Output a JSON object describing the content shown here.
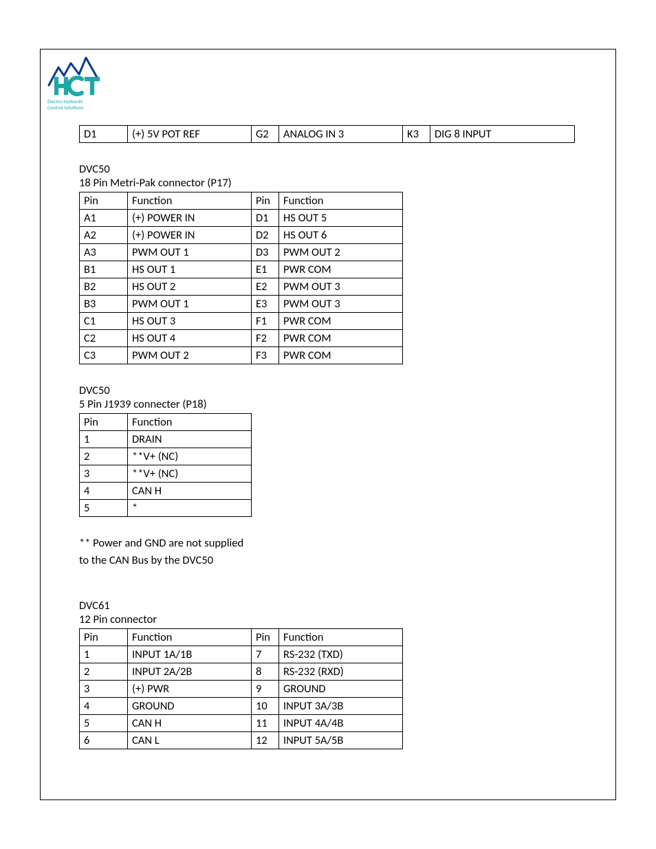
{
  "logo": {
    "line1": "Electro-Hydraulic",
    "line2": "Control Solutions"
  },
  "top_row": {
    "cells": [
      "D1",
      "(+) 5V POT REF",
      "G2",
      "ANALOG IN 3",
      "K3",
      "DIG 8 INPUT"
    ]
  },
  "table1": {
    "title": "DVC50",
    "subtitle": "18 Pin Metri-Pak connector (P17)",
    "headers": [
      "Pin",
      "Function",
      "Pin",
      "Function"
    ],
    "rows": [
      [
        "A1",
        "(+) POWER IN",
        "D1",
        "HS OUT 5"
      ],
      [
        "A2",
        "(+) POWER IN",
        "D2",
        "HS OUT 6"
      ],
      [
        "A3",
        "PWM OUT 1",
        "D3",
        "PWM OUT 2"
      ],
      [
        "B1",
        "HS OUT 1",
        "E1",
        "PWR COM"
      ],
      [
        "B2",
        "HS OUT 2",
        "E2",
        "PWM OUT 3"
      ],
      [
        "B3",
        "PWM OUT 1",
        "E3",
        "PWM OUT 3"
      ],
      [
        "C1",
        "HS OUT 3",
        "F1",
        "PWR COM"
      ],
      [
        "C2",
        "HS OUT 4",
        "F2",
        "PWR COM"
      ],
      [
        "C3",
        "PWM OUT 2",
        "F3",
        "PWR COM"
      ]
    ]
  },
  "table2": {
    "title": "DVC50",
    "subtitle": "5 Pin J1939 connecter (P18)",
    "headers": [
      "Pin",
      "Function"
    ],
    "rows": [
      [
        "1",
        "DRAIN"
      ],
      [
        "2",
        "**V+ (NC)"
      ],
      [
        "3",
        "**V+ (NC)"
      ],
      [
        "4",
        "CAN H"
      ],
      [
        "5",
        "*"
      ]
    ]
  },
  "note": {
    "line1": "** Power and GND are not supplied",
    "line2": "to the CAN Bus by the DVC50"
  },
  "table3": {
    "title": "DVC61",
    "subtitle": "12 Pin connector",
    "headers": [
      "Pin",
      "Function",
      "Pin",
      "Function"
    ],
    "rows": [
      [
        "1",
        "INPUT 1A/1B",
        "7",
        "RS-232 (TXD)"
      ],
      [
        "2",
        "INPUT 2A/2B",
        "8",
        "RS-232 (RXD)"
      ],
      [
        "3",
        "(+) PWR",
        "9",
        "GROUND"
      ],
      [
        "4",
        "GROUND",
        "10",
        "INPUT 3A/3B"
      ],
      [
        "5",
        "CAN H",
        "11",
        "INPUT 4A/4B"
      ],
      [
        "6",
        "CAN L",
        "12",
        "INPUT 5A/5B"
      ]
    ]
  }
}
